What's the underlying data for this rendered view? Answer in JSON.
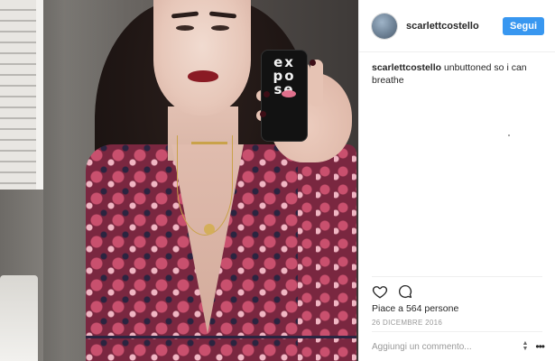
{
  "post": {
    "photo": {
      "phone_case_text": "ex\npo\nse",
      "alt": "photo"
    },
    "header": {
      "username": "scarlettcostello",
      "follow_label": "Segui"
    },
    "caption": {
      "username": "scarlettcostello",
      "text": " unbuttoned so i can breathe"
    },
    "actions": {
      "like_icon": "heart-icon",
      "comment_icon": "comment-bubble-icon"
    },
    "likes_text": "Piace a 564 persone",
    "date_text": "26 DICEMBRE 2016",
    "comment": {
      "placeholder": "Aggiungi un commento...",
      "more_label": "•••"
    },
    "colors": {
      "follow_button": "#3897f0",
      "text": "#262626",
      "muted": "#999999"
    }
  }
}
